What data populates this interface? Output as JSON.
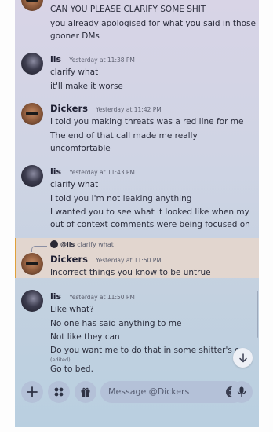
{
  "messages": [
    {
      "author": "",
      "timestamp": "",
      "lines": [
        "CAN YOU PLEASE CLARIFY SOME SHIT",
        "you already apologised for what you said in those gooner DMs"
      ]
    },
    {
      "author": "lis",
      "timestamp": "Yesterday at 11:38 PM",
      "lines": [
        "clarify what",
        "it'll make it worse"
      ]
    },
    {
      "author": "Dickers",
      "timestamp": "Yesterday at 11:42 PM",
      "lines": [
        "I told you making threats was a red line for me",
        "The end of that call made me really uncomfortable"
      ]
    },
    {
      "author": "lis",
      "timestamp": "Yesterday at 11:43 PM",
      "lines": [
        "clarify what",
        "I told you I'm not leaking anything",
        "I wanted you to see what it looked like when my out of context comments were being focused on"
      ]
    },
    {
      "reply_to": {
        "name": "@lis",
        "text": "clarify what"
      },
      "author": "Dickers",
      "timestamp": "Yesterday at 11:50 PM",
      "lines": [
        "Incorrect things you know to be untrue"
      ]
    },
    {
      "author": "lis",
      "timestamp": "Yesterday at 11:50 PM",
      "lines": [
        "Like what?",
        "No one has said anything to me",
        "Not like they can",
        "Do you want me to do that in some shitter's ch",
        "Go to bed."
      ],
      "edited_label": "(edited)"
    }
  ],
  "composer": {
    "placeholder": "Message @Dickers"
  },
  "icons": {
    "add": "plus-icon",
    "apps": "apps-icon",
    "gift": "gift-icon",
    "emoji": "emoji-icon",
    "mic": "microphone-icon",
    "scroll": "arrow-down-icon"
  },
  "colors": {
    "reply_highlight": "#e2d6cf",
    "reply_accent": "#e0a13a",
    "input_bg": "#b4c1d8"
  }
}
